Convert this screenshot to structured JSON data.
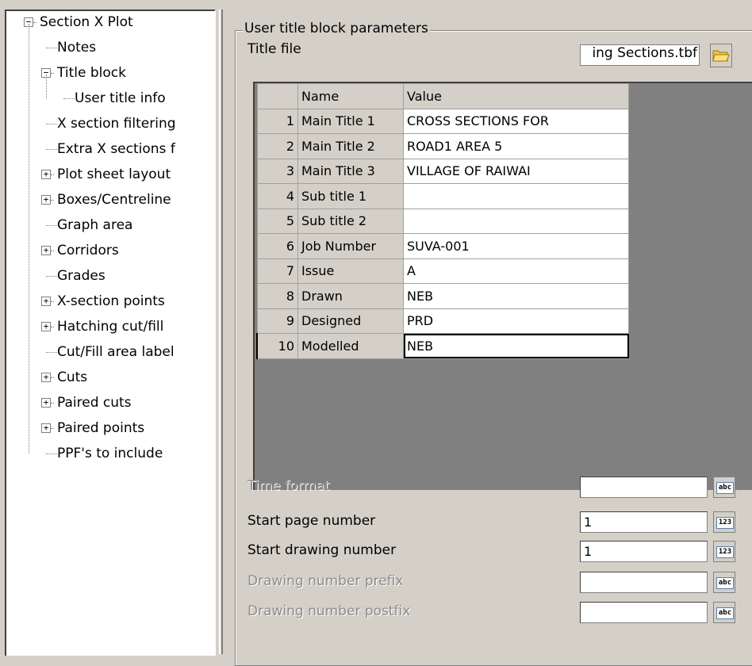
{
  "tree": {
    "items": [
      {
        "label": "Section X Plot",
        "expander": "−"
      },
      {
        "label": "Notes"
      },
      {
        "label": "Title block",
        "expander": "−"
      },
      {
        "label": "User title info"
      },
      {
        "label": "X section filtering"
      },
      {
        "label": "Extra X sections f"
      },
      {
        "label": "Plot sheet layout",
        "expander": "+"
      },
      {
        "label": "Boxes/Centreline",
        "expander": "+"
      },
      {
        "label": "Graph area"
      },
      {
        "label": "Corridors",
        "expander": "+"
      },
      {
        "label": "Grades"
      },
      {
        "label": "X-section points",
        "expander": "+"
      },
      {
        "label": "Hatching cut/fill",
        "expander": "+"
      },
      {
        "label": "Cut/Fill area label"
      },
      {
        "label": "Cuts",
        "expander": "+"
      },
      {
        "label": "Paired cuts",
        "expander": "+"
      },
      {
        "label": "Paired points",
        "expander": "+"
      },
      {
        "label": "PPF's to include"
      }
    ]
  },
  "panel": {
    "group_title": "User title block parameters",
    "title_file_label": "Title file",
    "title_file_value": "ing Sections.tbf",
    "folder_icon": "folder-open-icon"
  },
  "grid": {
    "headers": [
      "",
      "Name",
      "Value"
    ],
    "rows": [
      {
        "num": "1",
        "name": "Main Title 1",
        "value": "CROSS SECTIONS FOR"
      },
      {
        "num": "2",
        "name": "Main Title 2",
        "value": "ROAD1 AREA 5"
      },
      {
        "num": "3",
        "name": "Main Title 3",
        "value": "VILLAGE OF RAIWAI"
      },
      {
        "num": "4",
        "name": "Sub title 1",
        "value": ""
      },
      {
        "num": "5",
        "name": "Sub title 2",
        "value": ""
      },
      {
        "num": "6",
        "name": "Job Number",
        "value": "SUVA-001"
      },
      {
        "num": "7",
        "name": "Issue",
        "value": "A"
      },
      {
        "num": "8",
        "name": "Drawn",
        "value": "NEB"
      },
      {
        "num": "9",
        "name": "Designed",
        "value": "PRD"
      },
      {
        "num": "10",
        "name": "Modelled",
        "value": "NEB"
      }
    ]
  },
  "fields": [
    {
      "label": "Time format",
      "value": "",
      "button": "abc",
      "enabled": false
    },
    {
      "label": "Start page number",
      "value": "1",
      "button": "123",
      "enabled": true
    },
    {
      "label": "Start drawing number",
      "value": "1",
      "button": "123",
      "enabled": true
    },
    {
      "label": "Drawing number prefix",
      "value": "",
      "button": "abc",
      "enabled": false
    },
    {
      "label": "Drawing number postfix",
      "value": "",
      "button": "abc",
      "enabled": false
    }
  ]
}
